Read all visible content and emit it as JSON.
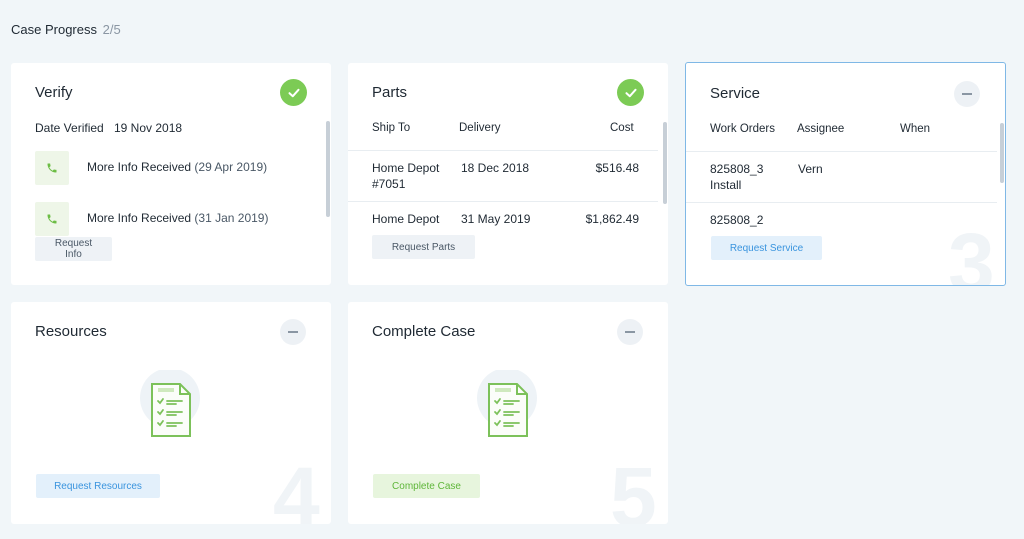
{
  "header": {
    "title": "Case Progress",
    "count": "2/5"
  },
  "verify": {
    "title": "Verify",
    "date_label": "Date Verified",
    "date_value": "19 Nov 2018",
    "items": [
      {
        "text": "More Info Received",
        "date": "(29 Apr 2019)",
        "icon": "phone-icon"
      },
      {
        "text": "More Info Received",
        "date": "(31 Jan 2019)",
        "icon": "phone-icon"
      }
    ],
    "button": "Request Info",
    "status_icon": "check-icon"
  },
  "parts": {
    "title": "Parts",
    "columns": [
      "Ship To",
      "Delivery",
      "Cost"
    ],
    "rows": [
      {
        "ship_to_1": "Home Depot",
        "ship_to_2": "#7051",
        "delivery": "18 Dec 2018",
        "cost": "$516.48"
      },
      {
        "ship_to_1": "Home Depot",
        "ship_to_2": "",
        "delivery": "31 May 2019",
        "cost": "$1,862.49"
      }
    ],
    "button": "Request Parts",
    "status_icon": "check-icon"
  },
  "service": {
    "title": "Service",
    "columns": [
      "Work Orders",
      "Assignee",
      "When"
    ],
    "rows": [
      {
        "order_1": "825808_3",
        "order_2": "Install",
        "assignee": "Vern",
        "when": ""
      },
      {
        "order_1": "825808_2",
        "order_2": "",
        "assignee": "",
        "when": ""
      }
    ],
    "button": "Request Service",
    "number": "3",
    "status_icon": "minus-icon"
  },
  "resources": {
    "title": "Resources",
    "button": "Request Resources",
    "number": "4",
    "status_icon": "minus-icon",
    "illustration": "document-checklist-icon"
  },
  "complete": {
    "title": "Complete Case",
    "button": "Complete Case",
    "number": "5",
    "status_icon": "minus-icon",
    "illustration": "document-checklist-icon"
  },
  "colors": {
    "background": "#f1f6f9",
    "success_green": "#7ccb55",
    "accent_blue": "#3a94de",
    "active_border": "#7fb8e6"
  }
}
